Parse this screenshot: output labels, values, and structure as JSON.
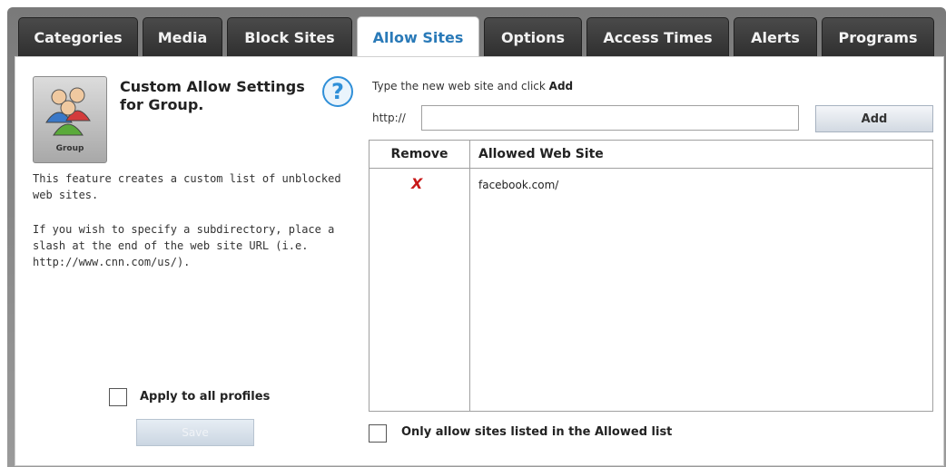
{
  "tabs": [
    {
      "label": "Categories"
    },
    {
      "label": "Media"
    },
    {
      "label": "Block Sites"
    },
    {
      "label": "Allow Sites",
      "active": true
    },
    {
      "label": "Options"
    },
    {
      "label": "Access Times"
    },
    {
      "label": "Alerts"
    },
    {
      "label": "Programs"
    }
  ],
  "left_panel": {
    "group_label": "Group",
    "title": "Custom Allow Settings for Group.",
    "description_1": "This feature creates a custom list of unblocked web sites.",
    "description_2": "If you wish to specify a subdirectory, place a slash at the end of the web site URL (i.e. http://www.cnn.com/us/).",
    "apply_all_label": "Apply to all profiles",
    "save_label": "Save"
  },
  "right_panel": {
    "instruction_prefix": "Type the new web site and click",
    "instruction_bold": "Add",
    "http_label": "http://",
    "url_value": "",
    "add_label": "Add",
    "table": {
      "headers": {
        "remove": "Remove",
        "site": "Allowed Web Site"
      },
      "rows": [
        {
          "remove_symbol": "X",
          "site": "facebook.com/"
        }
      ]
    },
    "only_allow_label": "Only allow sites listed in the Allowed list"
  },
  "colors": {
    "active_tab_text": "#2a7ab8",
    "remove_red": "#c81818",
    "help_blue": "#2f8fd8"
  },
  "icons": {
    "group": "group-icon",
    "help": "help-icon",
    "remove": "remove-icon"
  }
}
